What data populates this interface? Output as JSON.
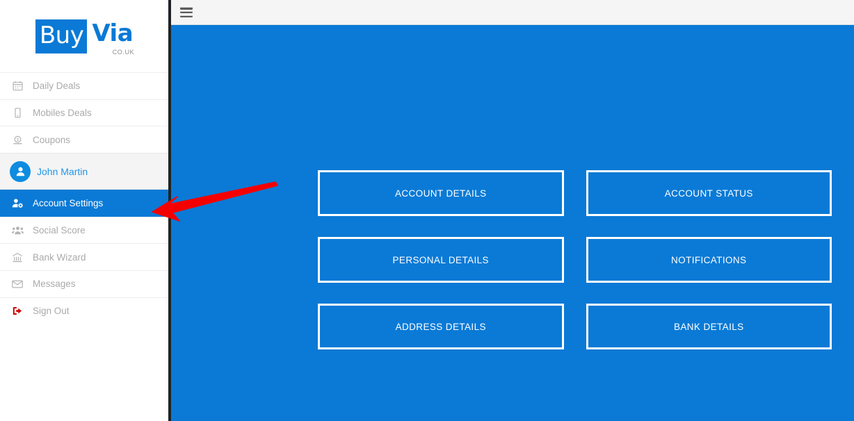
{
  "brand": {
    "name_part1": "Buy",
    "name_part2": "Via",
    "tld": "CO.UK",
    "blue": "#0a7ad6"
  },
  "topbar": {
    "menu_icon": "hamburger-icon"
  },
  "sidebar": {
    "items": [
      {
        "label": "Daily Deals",
        "icon": "calendar-icon",
        "state": "default"
      },
      {
        "label": "Mobiles Deals",
        "icon": "mobile-phone-icon",
        "state": "default"
      },
      {
        "label": "Coupons",
        "icon": "money-bill-icon",
        "state": "default"
      }
    ],
    "user": {
      "label": "John Martin",
      "icon": "user-avatar-icon"
    },
    "items_after": [
      {
        "label": "Account Settings",
        "icon": "user-gear-icon",
        "state": "active"
      },
      {
        "label": "Social Score",
        "icon": "users-group-icon",
        "state": "default"
      },
      {
        "label": "Bank Wizard",
        "icon": "bank-icon",
        "state": "default"
      },
      {
        "label": "Messages",
        "icon": "envelope-icon",
        "state": "default"
      },
      {
        "label": "Sign Out",
        "icon": "sign-out-icon",
        "state": "default"
      }
    ]
  },
  "main": {
    "tiles": [
      [
        "ACCOUNT DETAILS",
        "ACCOUNT STATUS"
      ],
      [
        "PERSONAL DETAILS",
        "NOTIFICATIONS"
      ],
      [
        "ADDRESS DETAILS",
        "BANK DETAILS"
      ]
    ],
    "tile_labels": {
      "r0c0": "ACCOUNT DETAILS",
      "r0c1": "ACCOUNT STATUS",
      "r1c0": "PERSONAL DETAILS",
      "r1c1": "NOTIFICATIONS",
      "r2c0": "ADDRESS DETAILS",
      "r2c1": "BANK DETAILS"
    }
  },
  "annotation": {
    "arrow_color": "#f40000",
    "points_to": "Account Settings"
  }
}
